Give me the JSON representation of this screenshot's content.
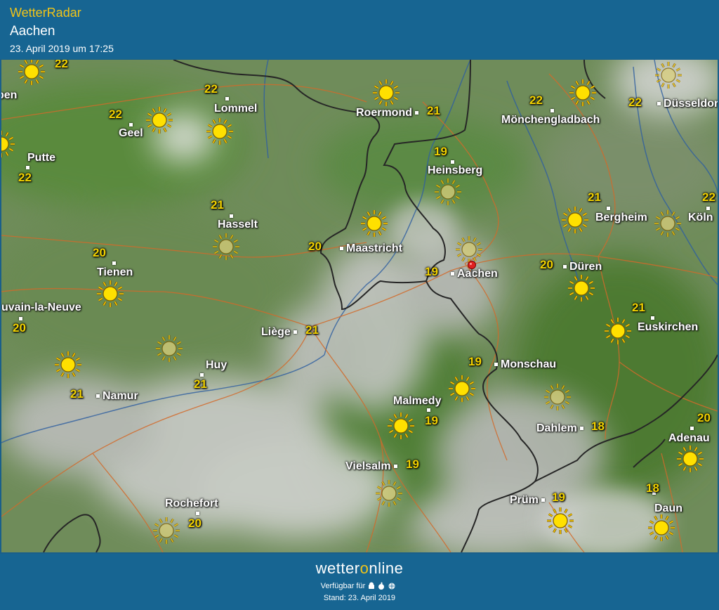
{
  "header": {
    "app_title": "WetterRadar",
    "place": "Aachen",
    "timestamp": "23. April 2019 um 17:25"
  },
  "cities": [
    {
      "id": "roermond",
      "name": "Roermond",
      "temp": "21"
    },
    {
      "id": "moenchengladbach",
      "name": "Mönchengladbach",
      "temp": "22"
    },
    {
      "id": "duesseldorf",
      "name": "Düsseldorf",
      "temp": "22"
    },
    {
      "id": "lommel",
      "name": "Lommel",
      "temp": "22"
    },
    {
      "id": "geel",
      "name": "Geel",
      "temp": "22"
    },
    {
      "id": "putte",
      "name": "Putte",
      "temp": "22"
    },
    {
      "id": "heinsberg",
      "name": "Heinsberg",
      "temp": "19"
    },
    {
      "id": "hasselt",
      "name": "Hasselt",
      "temp": "21"
    },
    {
      "id": "bergheim",
      "name": "Bergheim",
      "temp": "21"
    },
    {
      "id": "koeln",
      "name": "Köln",
      "temp": "22"
    },
    {
      "id": "maastricht",
      "name": "Maastricht",
      "temp": "20"
    },
    {
      "id": "tienen",
      "name": "Tienen",
      "temp": "20"
    },
    {
      "id": "aachen",
      "name": "Aachen",
      "temp": "19"
    },
    {
      "id": "dueren",
      "name": "Düren",
      "temp": "20"
    },
    {
      "id": "louvain",
      "name": "uvain-la-Neuve",
      "temp": "20"
    },
    {
      "id": "euskirchen",
      "name": "Euskirchen",
      "temp": "21"
    },
    {
      "id": "liege",
      "name": "Liège",
      "temp": "21"
    },
    {
      "id": "monschau",
      "name": "Monschau",
      "temp": "19"
    },
    {
      "id": "huy",
      "name": "Huy",
      "temp": "21"
    },
    {
      "id": "namur",
      "name": "Namur",
      "temp": "21"
    },
    {
      "id": "malmedy",
      "name": "Malmedy",
      "temp": "19"
    },
    {
      "id": "dahlem",
      "name": "Dahlem",
      "temp": "18"
    },
    {
      "id": "adenau",
      "name": "Adenau",
      "temp": "20"
    },
    {
      "id": "vielsalm",
      "name": "Vielsalm",
      "temp": "19"
    },
    {
      "id": "pruem",
      "name": "Prüm",
      "temp": "19"
    },
    {
      "id": "rochefort",
      "name": "Rochefort",
      "temp": "20"
    },
    {
      "id": "daun",
      "name": "Daun",
      "temp": "18"
    },
    {
      "id": "edge_topleft",
      "name": "",
      "temp": "22"
    },
    {
      "id": "edge_left",
      "name": "pen",
      "temp": ""
    }
  ],
  "weather_icons": [
    "sun-icon",
    "sun-icon-hazy"
  ],
  "colors": {
    "brand_blue": "#176592",
    "temp_yellow": "#f2d200",
    "title_yellow": "#f0c419",
    "marker_red": "#e02020"
  },
  "footer": {
    "brand_prefix": "wetter",
    "brand_o": "o",
    "brand_suffix": "nline",
    "available_label": "Verfügbar für",
    "stand": "Stand: 23. April 2019"
  }
}
